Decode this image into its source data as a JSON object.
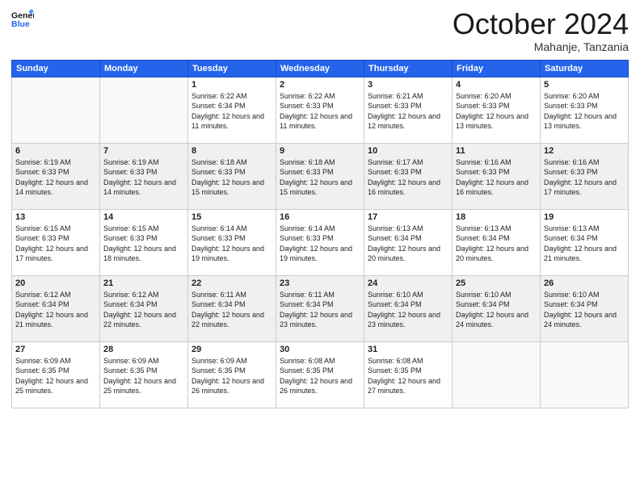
{
  "header": {
    "logo_line1": "General",
    "logo_line2": "Blue",
    "month_title": "October 2024",
    "subtitle": "Mahanje, Tanzania"
  },
  "weekdays": [
    "Sunday",
    "Monday",
    "Tuesday",
    "Wednesday",
    "Thursday",
    "Friday",
    "Saturday"
  ],
  "rows": [
    [
      {
        "day": "",
        "sunrise": "",
        "sunset": "",
        "daylight": ""
      },
      {
        "day": "",
        "sunrise": "",
        "sunset": "",
        "daylight": ""
      },
      {
        "day": "1",
        "sunrise": "Sunrise: 6:22 AM",
        "sunset": "Sunset: 6:34 PM",
        "daylight": "Daylight: 12 hours and 11 minutes."
      },
      {
        "day": "2",
        "sunrise": "Sunrise: 6:22 AM",
        "sunset": "Sunset: 6:33 PM",
        "daylight": "Daylight: 12 hours and 11 minutes."
      },
      {
        "day": "3",
        "sunrise": "Sunrise: 6:21 AM",
        "sunset": "Sunset: 6:33 PM",
        "daylight": "Daylight: 12 hours and 12 minutes."
      },
      {
        "day": "4",
        "sunrise": "Sunrise: 6:20 AM",
        "sunset": "Sunset: 6:33 PM",
        "daylight": "Daylight: 12 hours and 13 minutes."
      },
      {
        "day": "5",
        "sunrise": "Sunrise: 6:20 AM",
        "sunset": "Sunset: 6:33 PM",
        "daylight": "Daylight: 12 hours and 13 minutes."
      }
    ],
    [
      {
        "day": "6",
        "sunrise": "Sunrise: 6:19 AM",
        "sunset": "Sunset: 6:33 PM",
        "daylight": "Daylight: 12 hours and 14 minutes."
      },
      {
        "day": "7",
        "sunrise": "Sunrise: 6:19 AM",
        "sunset": "Sunset: 6:33 PM",
        "daylight": "Daylight: 12 hours and 14 minutes."
      },
      {
        "day": "8",
        "sunrise": "Sunrise: 6:18 AM",
        "sunset": "Sunset: 6:33 PM",
        "daylight": "Daylight: 12 hours and 15 minutes."
      },
      {
        "day": "9",
        "sunrise": "Sunrise: 6:18 AM",
        "sunset": "Sunset: 6:33 PM",
        "daylight": "Daylight: 12 hours and 15 minutes."
      },
      {
        "day": "10",
        "sunrise": "Sunrise: 6:17 AM",
        "sunset": "Sunset: 6:33 PM",
        "daylight": "Daylight: 12 hours and 16 minutes."
      },
      {
        "day": "11",
        "sunrise": "Sunrise: 6:16 AM",
        "sunset": "Sunset: 6:33 PM",
        "daylight": "Daylight: 12 hours and 16 minutes."
      },
      {
        "day": "12",
        "sunrise": "Sunrise: 6:16 AM",
        "sunset": "Sunset: 6:33 PM",
        "daylight": "Daylight: 12 hours and 17 minutes."
      }
    ],
    [
      {
        "day": "13",
        "sunrise": "Sunrise: 6:15 AM",
        "sunset": "Sunset: 6:33 PM",
        "daylight": "Daylight: 12 hours and 17 minutes."
      },
      {
        "day": "14",
        "sunrise": "Sunrise: 6:15 AM",
        "sunset": "Sunset: 6:33 PM",
        "daylight": "Daylight: 12 hours and 18 minutes."
      },
      {
        "day": "15",
        "sunrise": "Sunrise: 6:14 AM",
        "sunset": "Sunset: 6:33 PM",
        "daylight": "Daylight: 12 hours and 19 minutes."
      },
      {
        "day": "16",
        "sunrise": "Sunrise: 6:14 AM",
        "sunset": "Sunset: 6:33 PM",
        "daylight": "Daylight: 12 hours and 19 minutes."
      },
      {
        "day": "17",
        "sunrise": "Sunrise: 6:13 AM",
        "sunset": "Sunset: 6:34 PM",
        "daylight": "Daylight: 12 hours and 20 minutes."
      },
      {
        "day": "18",
        "sunrise": "Sunrise: 6:13 AM",
        "sunset": "Sunset: 6:34 PM",
        "daylight": "Daylight: 12 hours and 20 minutes."
      },
      {
        "day": "19",
        "sunrise": "Sunrise: 6:13 AM",
        "sunset": "Sunset: 6:34 PM",
        "daylight": "Daylight: 12 hours and 21 minutes."
      }
    ],
    [
      {
        "day": "20",
        "sunrise": "Sunrise: 6:12 AM",
        "sunset": "Sunset: 6:34 PM",
        "daylight": "Daylight: 12 hours and 21 minutes."
      },
      {
        "day": "21",
        "sunrise": "Sunrise: 6:12 AM",
        "sunset": "Sunset: 6:34 PM",
        "daylight": "Daylight: 12 hours and 22 minutes."
      },
      {
        "day": "22",
        "sunrise": "Sunrise: 6:11 AM",
        "sunset": "Sunset: 6:34 PM",
        "daylight": "Daylight: 12 hours and 22 minutes."
      },
      {
        "day": "23",
        "sunrise": "Sunrise: 6:11 AM",
        "sunset": "Sunset: 6:34 PM",
        "daylight": "Daylight: 12 hours and 23 minutes."
      },
      {
        "day": "24",
        "sunrise": "Sunrise: 6:10 AM",
        "sunset": "Sunset: 6:34 PM",
        "daylight": "Daylight: 12 hours and 23 minutes."
      },
      {
        "day": "25",
        "sunrise": "Sunrise: 6:10 AM",
        "sunset": "Sunset: 6:34 PM",
        "daylight": "Daylight: 12 hours and 24 minutes."
      },
      {
        "day": "26",
        "sunrise": "Sunrise: 6:10 AM",
        "sunset": "Sunset: 6:34 PM",
        "daylight": "Daylight: 12 hours and 24 minutes."
      }
    ],
    [
      {
        "day": "27",
        "sunrise": "Sunrise: 6:09 AM",
        "sunset": "Sunset: 6:35 PM",
        "daylight": "Daylight: 12 hours and 25 minutes."
      },
      {
        "day": "28",
        "sunrise": "Sunrise: 6:09 AM",
        "sunset": "Sunset: 6:35 PM",
        "daylight": "Daylight: 12 hours and 25 minutes."
      },
      {
        "day": "29",
        "sunrise": "Sunrise: 6:09 AM",
        "sunset": "Sunset: 6:35 PM",
        "daylight": "Daylight: 12 hours and 26 minutes."
      },
      {
        "day": "30",
        "sunrise": "Sunrise: 6:08 AM",
        "sunset": "Sunset: 6:35 PM",
        "daylight": "Daylight: 12 hours and 26 minutes."
      },
      {
        "day": "31",
        "sunrise": "Sunrise: 6:08 AM",
        "sunset": "Sunset: 6:35 PM",
        "daylight": "Daylight: 12 hours and 27 minutes."
      },
      {
        "day": "",
        "sunrise": "",
        "sunset": "",
        "daylight": ""
      },
      {
        "day": "",
        "sunrise": "",
        "sunset": "",
        "daylight": ""
      }
    ]
  ]
}
